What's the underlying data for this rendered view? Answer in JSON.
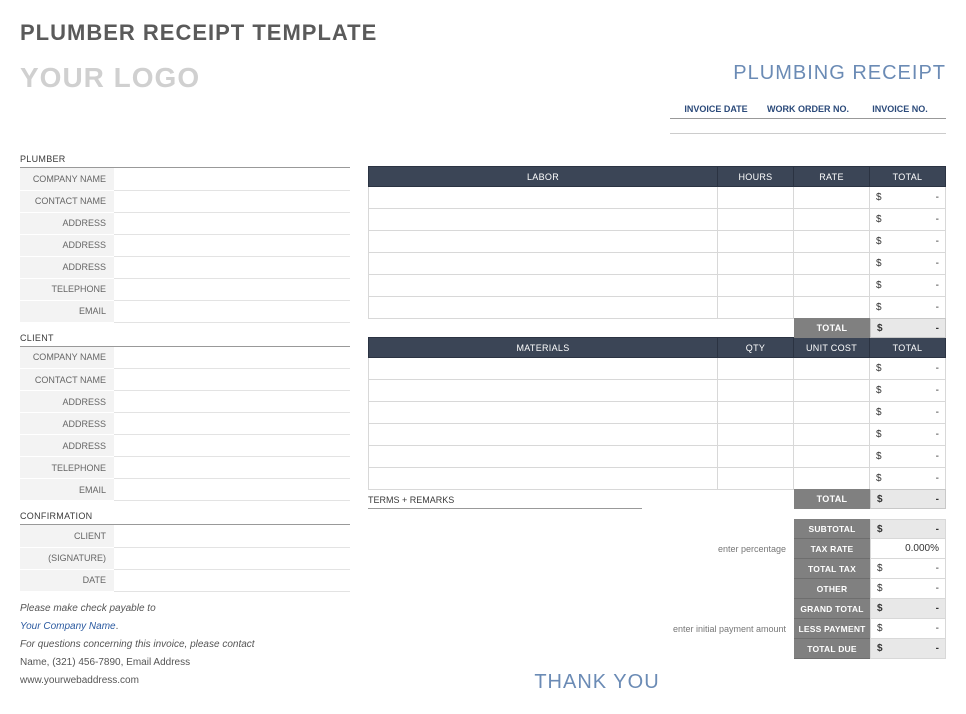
{
  "page_title": "PLUMBER RECEIPT TEMPLATE",
  "logo": "YOUR LOGO",
  "receipt_title": "PLUMBING RECEIPT",
  "invoice_meta": {
    "date_label": "INVOICE DATE",
    "work_order_label": "WORK ORDER NO.",
    "invoice_no_label": "INVOICE NO.",
    "date": "",
    "work_order": "",
    "invoice_no": ""
  },
  "sections": {
    "plumber": "PLUMBER",
    "client": "CLIENT",
    "confirmation": "CONFIRMATION",
    "terms": "TERMS + REMARKS"
  },
  "field_labels": {
    "company_name": "COMPANY NAME",
    "contact_name": "CONTACT NAME",
    "address": "ADDRESS",
    "telephone": "TELEPHONE",
    "email": "EMAIL",
    "client_conf": "CLIENT",
    "signature": "(SIGNATURE)",
    "date": "DATE"
  },
  "labor": {
    "headers": {
      "desc": "LABOR",
      "hours": "HOURS",
      "rate": "RATE",
      "total": "TOTAL"
    },
    "rows": [
      {
        "desc": "",
        "hours": "",
        "rate": "",
        "sym": "$",
        "dash": "-"
      },
      {
        "desc": "",
        "hours": "",
        "rate": "",
        "sym": "$",
        "dash": "-"
      },
      {
        "desc": "",
        "hours": "",
        "rate": "",
        "sym": "$",
        "dash": "-"
      },
      {
        "desc": "",
        "hours": "",
        "rate": "",
        "sym": "$",
        "dash": "-"
      },
      {
        "desc": "",
        "hours": "",
        "rate": "",
        "sym": "$",
        "dash": "-"
      },
      {
        "desc": "",
        "hours": "",
        "rate": "",
        "sym": "$",
        "dash": "-"
      }
    ],
    "total_label": "TOTAL",
    "total_sym": "$",
    "total_dash": "-"
  },
  "materials": {
    "headers": {
      "desc": "MATERIALS",
      "qty": "QTY",
      "unit": "UNIT COST",
      "total": "TOTAL"
    },
    "rows": [
      {
        "desc": "",
        "qty": "",
        "unit": "",
        "sym": "$",
        "dash": "-"
      },
      {
        "desc": "",
        "qty": "",
        "unit": "",
        "sym": "$",
        "dash": "-"
      },
      {
        "desc": "",
        "qty": "",
        "unit": "",
        "sym": "$",
        "dash": "-"
      },
      {
        "desc": "",
        "qty": "",
        "unit": "",
        "sym": "$",
        "dash": "-"
      },
      {
        "desc": "",
        "qty": "",
        "unit": "",
        "sym": "$",
        "dash": "-"
      },
      {
        "desc": "",
        "qty": "",
        "unit": "",
        "sym": "$",
        "dash": "-"
      }
    ],
    "total_label": "TOTAL",
    "total_sym": "$",
    "total_dash": "-"
  },
  "summary": {
    "subtotal": {
      "label": "SUBTOTAL",
      "sym": "$",
      "val": "-"
    },
    "tax_rate": {
      "label": "TAX RATE",
      "val": "0.000%",
      "note": "enter percentage"
    },
    "total_tax": {
      "label": "TOTAL TAX",
      "sym": "$",
      "val": "-"
    },
    "other": {
      "label": "OTHER",
      "sym": "$",
      "val": "-"
    },
    "grand_total": {
      "label": "GRAND TOTAL",
      "sym": "$",
      "val": "-"
    },
    "less_payment": {
      "label": "LESS PAYMENT",
      "sym": "$",
      "val": "-",
      "note": "enter initial payment amount"
    },
    "total_due": {
      "label": "TOTAL DUE",
      "sym": "$",
      "val": "-"
    }
  },
  "footer": {
    "payable": "Please make check payable to",
    "company_link": "Your Company Name",
    "dot": ".",
    "questions": "For questions concerning this invoice, please contact",
    "contact": "Name, (321) 456-7890, Email Address",
    "web": "www.yourwebaddress.com"
  },
  "thank_you": "THANK YOU"
}
